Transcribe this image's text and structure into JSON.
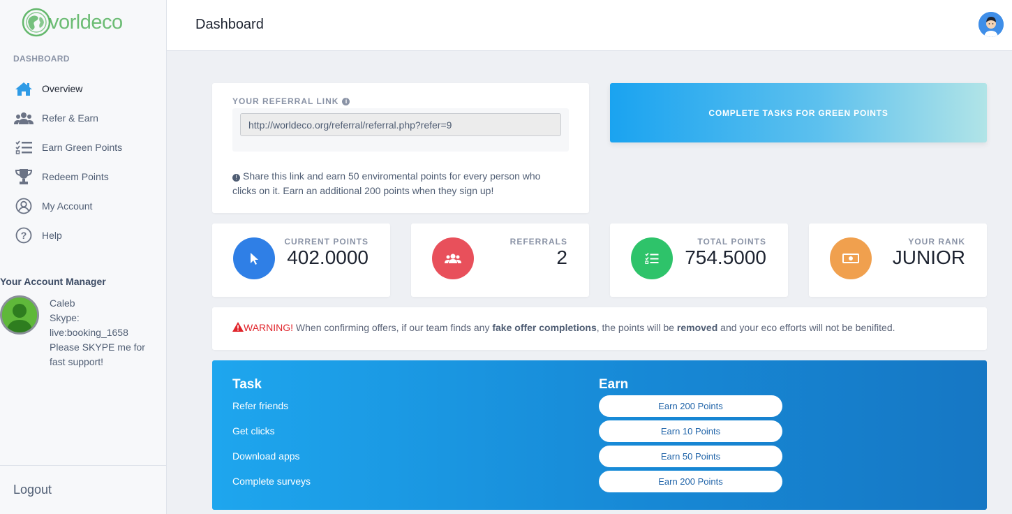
{
  "brand": {
    "name": "vorldeco",
    "color": "#3ea848"
  },
  "sidebar": {
    "section_title": "DASHBOARD",
    "items": [
      {
        "label": "Overview",
        "icon": "home-icon"
      },
      {
        "label": "Refer & Earn",
        "icon": "users-icon"
      },
      {
        "label": "Earn Green Points",
        "icon": "checklist-icon"
      },
      {
        "label": "Redeem Points",
        "icon": "trophy-icon"
      },
      {
        "label": "My Account",
        "icon": "user-circle-icon"
      },
      {
        "label": "Help",
        "icon": "help-icon"
      }
    ],
    "manager": {
      "title": "Your Account Manager",
      "name": "Caleb",
      "skype_label": "Skype:",
      "skype_id": "live:booking_1658",
      "note": "Please SKYPE me for fast support!"
    },
    "logout": "Logout"
  },
  "header": {
    "title": "Dashboard"
  },
  "referral": {
    "label": "YOUR REFERRAL LINK",
    "link": "http://worldeco.org/referral/referral.php?refer=9",
    "help": "Share this link and earn 50 enviromental points for every person who clicks on it. Earn an additional 200 points when they sign up!"
  },
  "cta": {
    "label": "COMPLETE TASKS FOR GREEN POINTS"
  },
  "stats": [
    {
      "label": "CURRENT POINTS",
      "value": "402.0000",
      "icon": "cursor-icon",
      "color": "#2f7fe6"
    },
    {
      "label": "REFERRALS",
      "value": "2",
      "icon": "group-icon",
      "color": "#e8505b"
    },
    {
      "label": "TOTAL POINTS",
      "value": "754.5000",
      "icon": "list-check-icon",
      "color": "#2ec36a"
    },
    {
      "label": "YOUR RANK",
      "value": "JUNIOR",
      "icon": "money-icon",
      "color": "#f0a04e"
    }
  ],
  "warning": {
    "prefix": "WARNING!",
    "part1": " When confirming offers, if our team finds any ",
    "bold1": "fake offer completions",
    "part2": ", the points will be ",
    "bold2": "removed",
    "part3": " and your eco efforts will not be benifited."
  },
  "tasks": {
    "task_header": "Task",
    "earn_header": "Earn",
    "rows": [
      {
        "task": "Refer friends",
        "earn": "Earn 200 Points"
      },
      {
        "task": "Get clicks",
        "earn": "Earn 10 Points"
      },
      {
        "task": "Download apps",
        "earn": "Earn 50 Points"
      },
      {
        "task": "Complete surveys",
        "earn": "Earn 200 Points"
      }
    ]
  }
}
